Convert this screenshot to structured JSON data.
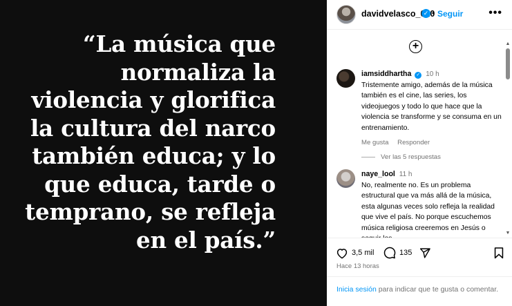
{
  "media": {
    "quote_lines": [
      "“La música que",
      "normaliza la",
      "violencia y glorifica",
      "la cultura del narco",
      "también educa; y lo",
      "que educa, tarde o",
      "temprano, se refleja",
      "en el país.”"
    ]
  },
  "header": {
    "username": "davidvelasco_010",
    "verified_icon": "✓",
    "separator": "•",
    "follow_label": "Seguir",
    "more_icon": "•••"
  },
  "comments": {
    "add_icon": "+",
    "items": [
      {
        "username": "iamsiddhartha",
        "verified": "✓",
        "time": "10 h",
        "text": "Tristemente amigo, además de la música también es el cine, las series, los videojuegos y todo lo que hace que la violencia se transforme y se consuma en un entrenamiento.",
        "like_label": "Me gusta",
        "reply_label": "Responder"
      },
      {
        "username": "naye_lool",
        "time": "11 h",
        "text": "No, realmente no. Es un problema estructural que va más allá de la música, esta algunas veces solo refleja la realidad que vive el país. No porque escuchemos música religiosa creeremos en Jesús o seguir los"
      }
    ],
    "see_replies": "Ver las 5 respuestas"
  },
  "actions": {
    "like_count": "3,5 mil",
    "comment_count": "135"
  },
  "timestamp": "Hace 13 horas",
  "login": {
    "link": "Inicia sesión",
    "text": " para indicar que te gusta o comentar."
  }
}
